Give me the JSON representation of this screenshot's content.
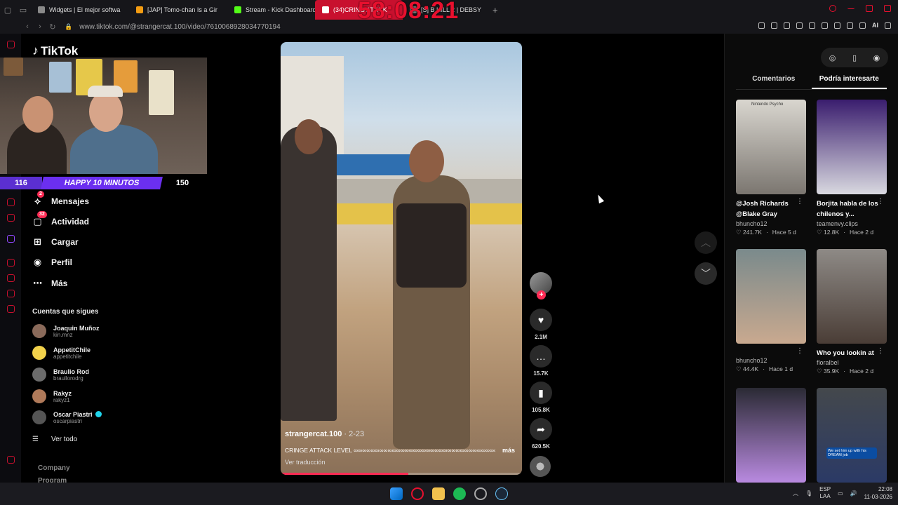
{
  "browser": {
    "tabs": [
      {
        "label": "Widgets | El mejor softwa",
        "color": "#8a8a8a"
      },
      {
        "label": "[JAP] Tomo-chan Is a Gir",
        "color": "#f39c12"
      },
      {
        "label": "Stream - Kick Dashboard",
        "color": "#53fc18"
      },
      {
        "label": "(34)CRING ATTA K",
        "color": "#ffffff",
        "active": true
      },
      {
        "label": "[S] B HILL 2 | DEBSY",
        "color": "#777777"
      }
    ],
    "overlay_clock": "58:08:21",
    "url": "www.tiktok.com/@strangercat.100/video/7610068928034770194",
    "ai_label": "AI"
  },
  "tiktok": {
    "logo_text": "TikTok",
    "webcam": {
      "left_count": "116",
      "banner": "HAPPY 10 MINUTOS",
      "right_count": "150"
    },
    "nav": [
      {
        "label": "Mensajes",
        "icon": "send-icon",
        "badge": "2"
      },
      {
        "label": "Actividad",
        "icon": "activity-icon",
        "badge": "32"
      },
      {
        "label": "Cargar",
        "icon": "upload-icon",
        "badge": ""
      },
      {
        "label": "Perfil",
        "icon": "profile-icon",
        "badge": ""
      },
      {
        "label": "Más",
        "icon": "more-icon",
        "badge": ""
      }
    ],
    "following_title": "Cuentas que sigues",
    "following": [
      {
        "name": "Joaquin Muñoz",
        "handle": "kin.mnz",
        "color": "#8a6a5a"
      },
      {
        "name": "AppetitChile",
        "handle": "appetitchile",
        "color": "#f2d24b"
      },
      {
        "name": "Braulio Rod",
        "handle": "braullorodrg",
        "color": "#6b6b6b"
      },
      {
        "name": "Rakyz",
        "handle": "rakyz1",
        "color": "#b07a5a"
      },
      {
        "name": "Oscar Piastri",
        "handle": "oscarpiastri",
        "color": "#555555",
        "verified": true
      }
    ],
    "see_all": "Ver todo",
    "footer": [
      "Company",
      "Program"
    ],
    "video": {
      "username": "strangercat.100",
      "date": " · 2-23",
      "caption": "CRINGE ATTACK LEVEL ∞∞∞∞∞∞∞∞∞∞∞∞∞∞∞∞∞∞∞∞∞∞∞∞∞∞∞∞∞∞∞∞∞∞∞∞∞∞ #cat -",
      "more": "más",
      "translate": "Ver traducción",
      "progress": 0.53
    },
    "actions": {
      "likes": "2.1M",
      "comments": "15.7K",
      "saves": "105.8K",
      "shares": "620.5K"
    },
    "right_panel": {
      "tabs": [
        "Comentarios",
        "Podría interesarte"
      ],
      "active_tab": 1,
      "cards": [
        {
          "title": "@Josh Richards @Blake Gray",
          "author": "bhuncho12",
          "views": "241.7K",
          "age": "Hace 5 d",
          "thumb_text": "Nintendo Psycho",
          "c1": "#d9d6cf",
          "c2": "#7b7670"
        },
        {
          "title": "Borjita habla de los chilenos y...",
          "author": "teamenvy.clips",
          "views": "12.8K",
          "age": "Hace 2 d",
          "thumb_text": "",
          "c1": "#3a1d6e",
          "c2": "#d9d9e0"
        },
        {
          "title": "",
          "author": "bhuncho12",
          "views": "44.4K",
          "age": "Hace 1 d",
          "thumb_text": "",
          "c1": "#7a8a8c",
          "c2": "#c9a98f"
        },
        {
          "title": "Who you lookin at",
          "author": "floralbel",
          "views": "35.9K",
          "age": "Hace 2 d",
          "thumb_text": "",
          "c1": "#8e8a86",
          "c2": "#4a3d36"
        },
        {
          "title": "",
          "author": "",
          "views": "",
          "age": "",
          "thumb_text": "",
          "c1": "#2a2a34",
          "c2": "#b98ae0"
        },
        {
          "title": "",
          "author": "",
          "views": "",
          "age": "",
          "thumb_text": "We set him up with his DREAM job",
          "c1": "#44484c",
          "c2": "#2b3a66"
        }
      ]
    }
  },
  "taskbar": {
    "lang_top": "ESP",
    "lang_bottom": "LAA",
    "time": "22:08",
    "date": "11-03-2026"
  }
}
